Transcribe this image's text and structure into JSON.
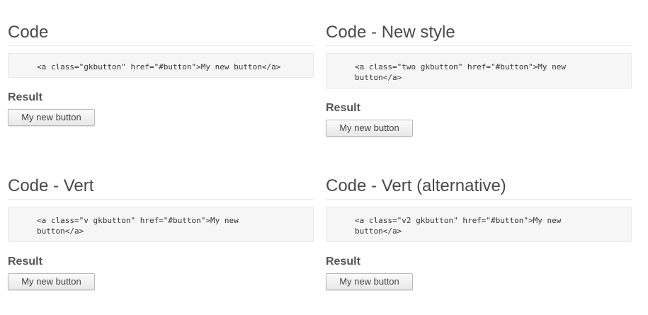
{
  "sections": [
    {
      "title": "Code",
      "code_lines": [
        "<a class=\"gkbutton\" href=\"#button\">My new button</a>"
      ],
      "result_label": "Result",
      "button_label": "My new button"
    },
    {
      "title": "Code - New style",
      "code_lines": [
        "<a class=\"two gkbutton\" href=\"#button\">My new",
        "button</a>"
      ],
      "result_label": "Result",
      "button_label": "My new button"
    },
    {
      "title": "Code - Vert",
      "code_lines": [
        "<a class=\"v gkbutton\" href=\"#button\">My new",
        "button</a>"
      ],
      "result_label": "Result",
      "button_label": "My new button"
    },
    {
      "title": "Code - Vert (alternative)",
      "code_lines": [
        "<a class=\"v2 gkbutton\" href=\"#button\">My new",
        "button</a>"
      ],
      "result_label": "Result",
      "button_label": "My new button"
    }
  ]
}
